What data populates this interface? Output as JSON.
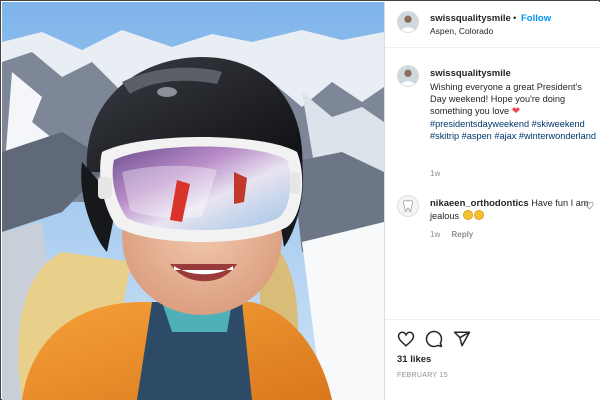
{
  "post": {
    "author": "swissqualitysmile",
    "follow_label": "Follow",
    "separator": "•",
    "location": "Aspen, Colorado",
    "caption_text": "Wishing everyone a great President's Day weekend! Hope you're doing something you love",
    "caption_emoji": "❤",
    "hashtags": "#presidentsdayweekend #skiweekend #skitrip #aspen #ajax #winterwonderland",
    "caption_time": "1w",
    "likes": "31 likes",
    "date": "FEBRUARY 15"
  },
  "comment": {
    "author": "nikaeen_orthodontics",
    "text": "Have fun I am jealous",
    "emoji_count": 2,
    "time": "1w",
    "reply_label": "Reply"
  },
  "icons": {
    "like": "heart-outline-icon",
    "comment": "speech-bubble-icon",
    "share": "paper-plane-icon",
    "comment_like": "heart-outline-icon"
  },
  "colors": {
    "follow": "#0095f6",
    "hashtag": "#00376b",
    "heart": "#ed4956",
    "secondary_text": "#8e8e8e"
  }
}
